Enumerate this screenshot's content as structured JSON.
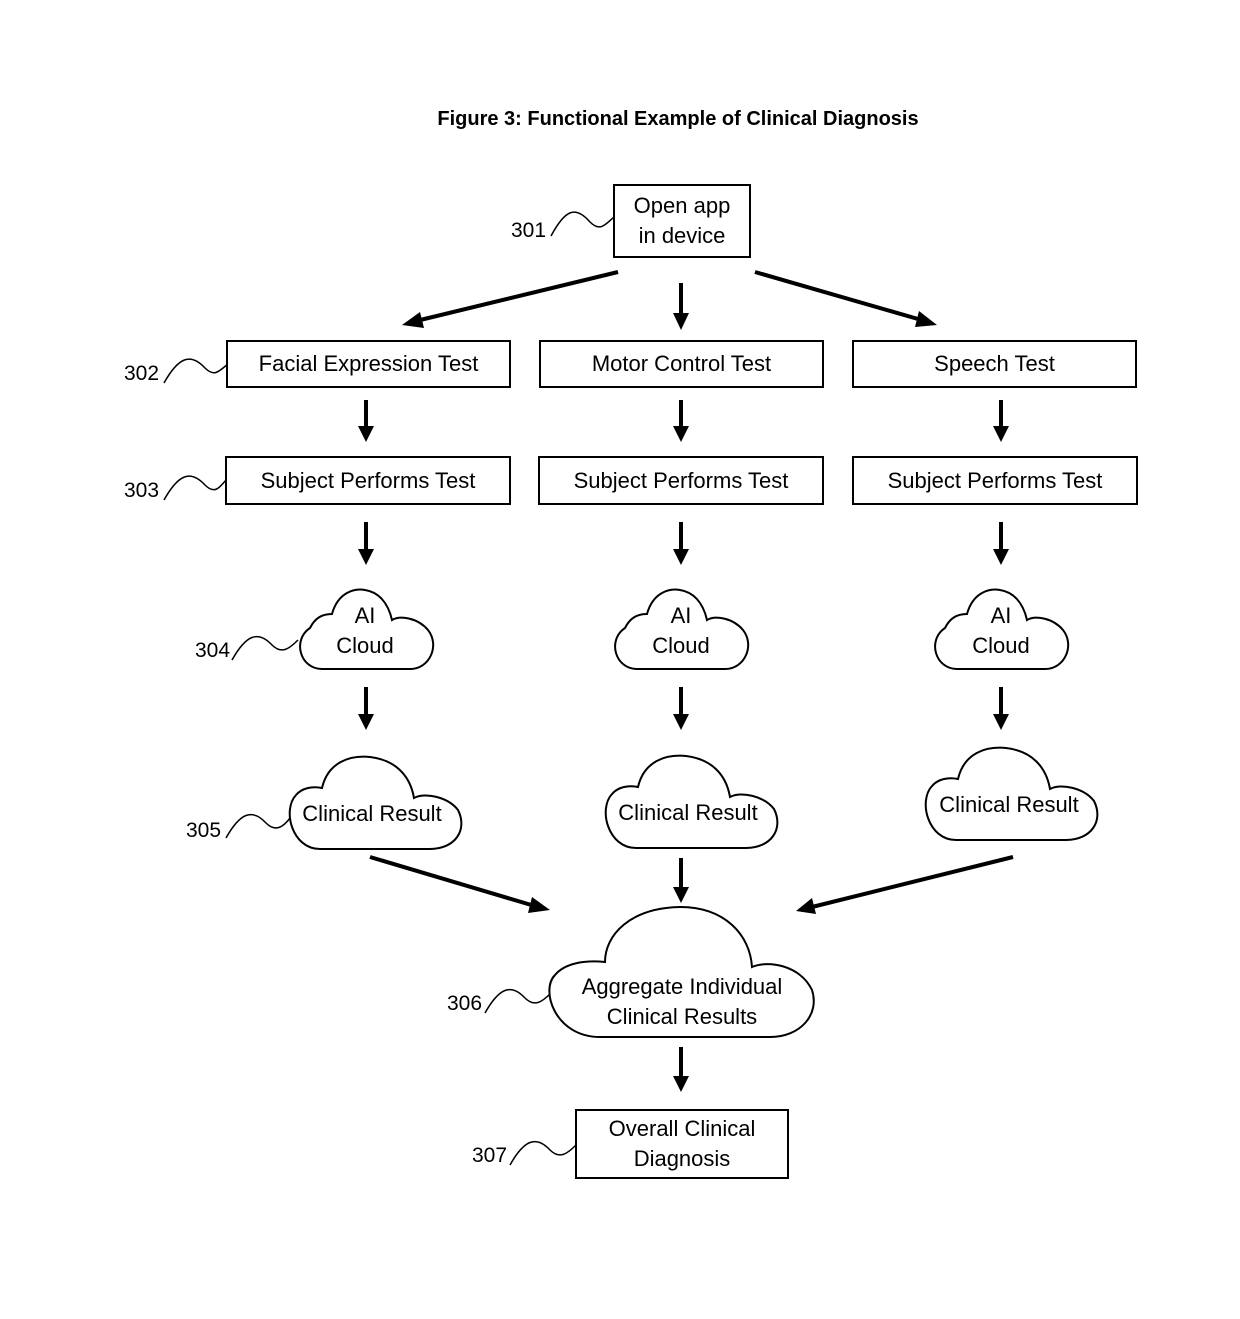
{
  "title": "Figure 3: Functional Example of Clinical Diagnosis",
  "nodes": {
    "open_app": {
      "ref": "301",
      "line1": "Open app",
      "line2": "in device"
    },
    "tests": [
      {
        "ref": "302",
        "label": "Facial Expression Test"
      },
      {
        "label": "Motor Control Test"
      },
      {
        "label": "Speech Test"
      }
    ],
    "perform": [
      {
        "ref": "303",
        "label": "Subject Performs Test"
      },
      {
        "label": "Subject Performs Test"
      },
      {
        "label": "Subject Performs Test"
      }
    ],
    "ai_cloud": [
      {
        "ref": "304",
        "line1": "AI",
        "line2": "Cloud"
      },
      {
        "line1": "AI",
        "line2": "Cloud"
      },
      {
        "line1": "AI",
        "line2": "Cloud"
      }
    ],
    "clinical_result": [
      {
        "ref": "305",
        "label": "Clinical Result"
      },
      {
        "label": "Clinical Result"
      },
      {
        "label": "Clinical Result"
      }
    ],
    "aggregate": {
      "ref": "306",
      "line1": "Aggregate Individual",
      "line2": "Clinical Results"
    },
    "overall": {
      "ref": "307",
      "line1": "Overall Clinical",
      "line2": "Diagnosis"
    }
  }
}
